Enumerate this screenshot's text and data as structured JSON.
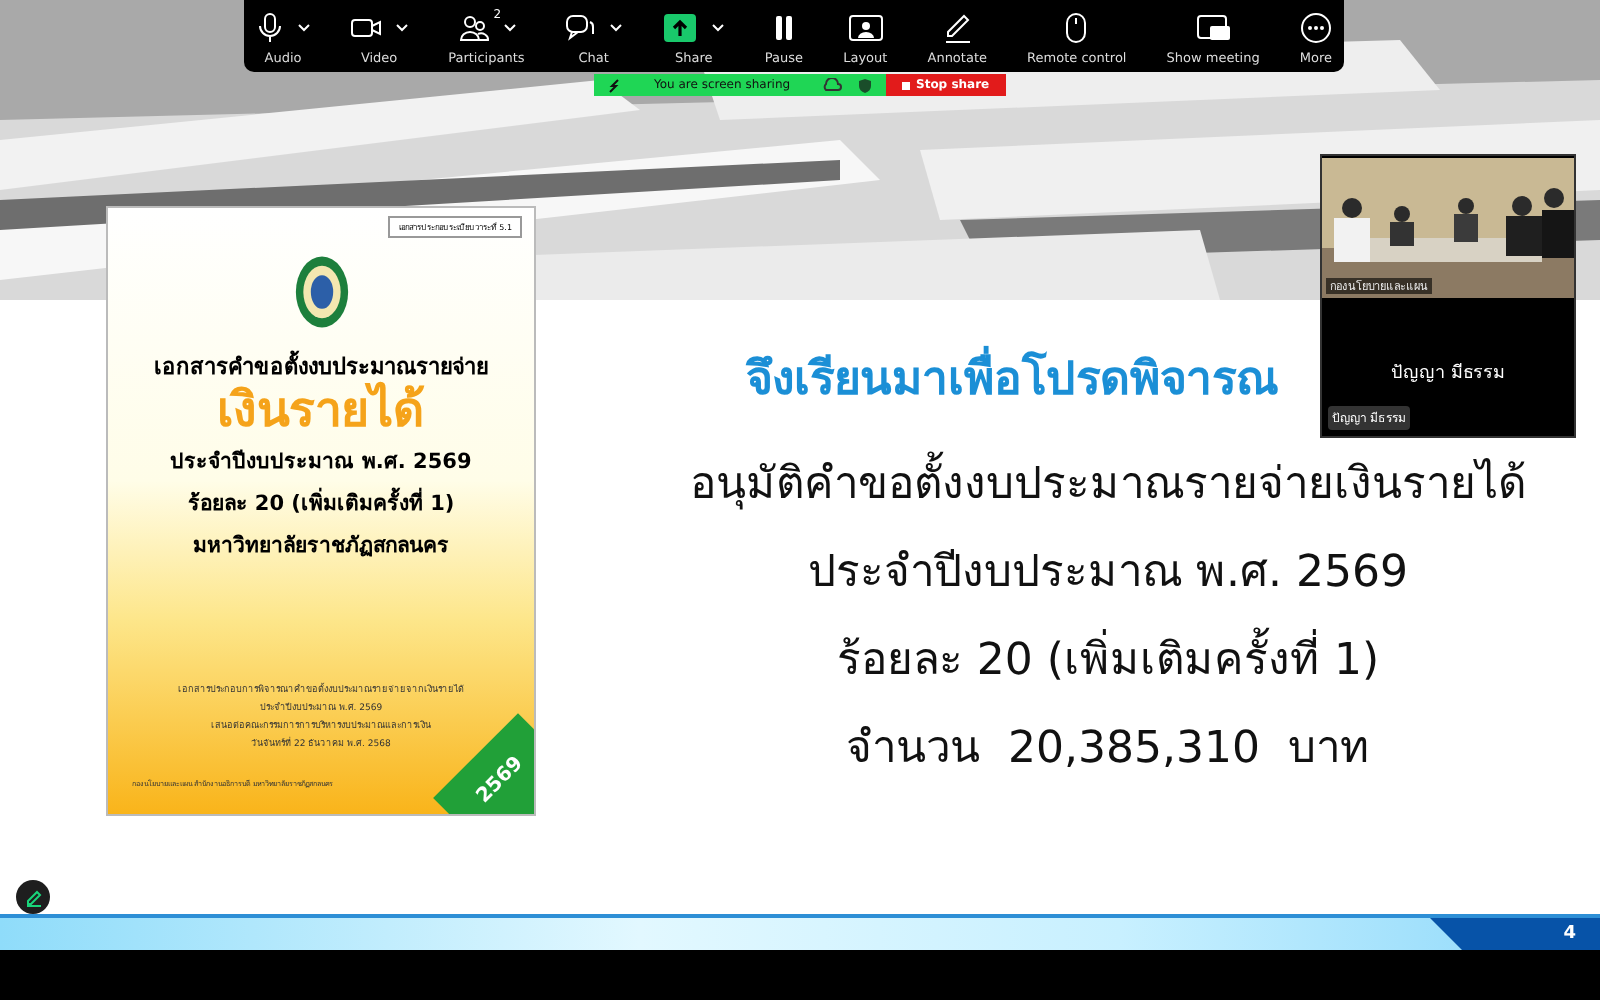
{
  "toolbar": {
    "items": [
      {
        "label": "Audio",
        "caret": true
      },
      {
        "label": "Video",
        "caret": true
      },
      {
        "label": "Participants",
        "caret": true,
        "badge": "2"
      },
      {
        "label": "Chat",
        "caret": true
      },
      {
        "label": "Share",
        "caret": true
      },
      {
        "label": "Pause",
        "caret": false
      },
      {
        "label": "Layout",
        "caret": false
      },
      {
        "label": "Annotate",
        "caret": false
      },
      {
        "label": "Remote control",
        "caret": false
      },
      {
        "label": "Show meeting",
        "caret": false
      },
      {
        "label": "More",
        "caret": false
      }
    ]
  },
  "sharing_bar": {
    "status": "You are screen sharing",
    "stop_button": "Stop share"
  },
  "slide": {
    "cover": {
      "tag": "เอกสารประกอบระเบียบวาระที่ 5.1",
      "title": "เอกสารคำขอตั้งงบประมาณรายจ่าย",
      "highlight": "เงินรายได้",
      "lines": [
        "ประจำปีงบประมาณ พ.ศ. 2569",
        "ร้อยละ 20 (เพิ่มเติมครั้งที่ 1)",
        "มหาวิทยาลัยราชภัฏสกลนคร"
      ],
      "notes": [
        "เอกสารประกอบการพิจารณาคำขอตั้งงบประมาณรายจ่ายจากเงินรายได้",
        "ประจำปีงบประมาณ พ.ศ. 2569",
        "เสนอต่อคณะกรรมการการบริหารงบประมาณและการเงิน",
        "วันจันทร์ที่ 22 ธันวาคม พ.ศ. 2568"
      ],
      "footer": "กองนโยบายและแผน สำนักงานอธิการบดี มหาวิทยาลัยราชภัฏสกลนคร",
      "corner": "2569"
    },
    "heading": "จึงเรียนมาเพื่อโปรดพิจารณ",
    "lines": [
      "อนุมัติคำขอตั้งงบประมาณรายจ่ายเงินรายได้",
      "ประจำปีงบประมาณ พ.ศ. 2569",
      "ร้อยละ 20 (เพิ่มเติมครั้งที่ 1)",
      "จำนวน  20,385,310  บาท"
    ],
    "page_number": "4"
  },
  "video_tile": {
    "room_label": "กองนโยบายและแผน",
    "participant": "ปัญญา มีธรรม",
    "name_tag": "ปัญญา มีธรรม"
  }
}
